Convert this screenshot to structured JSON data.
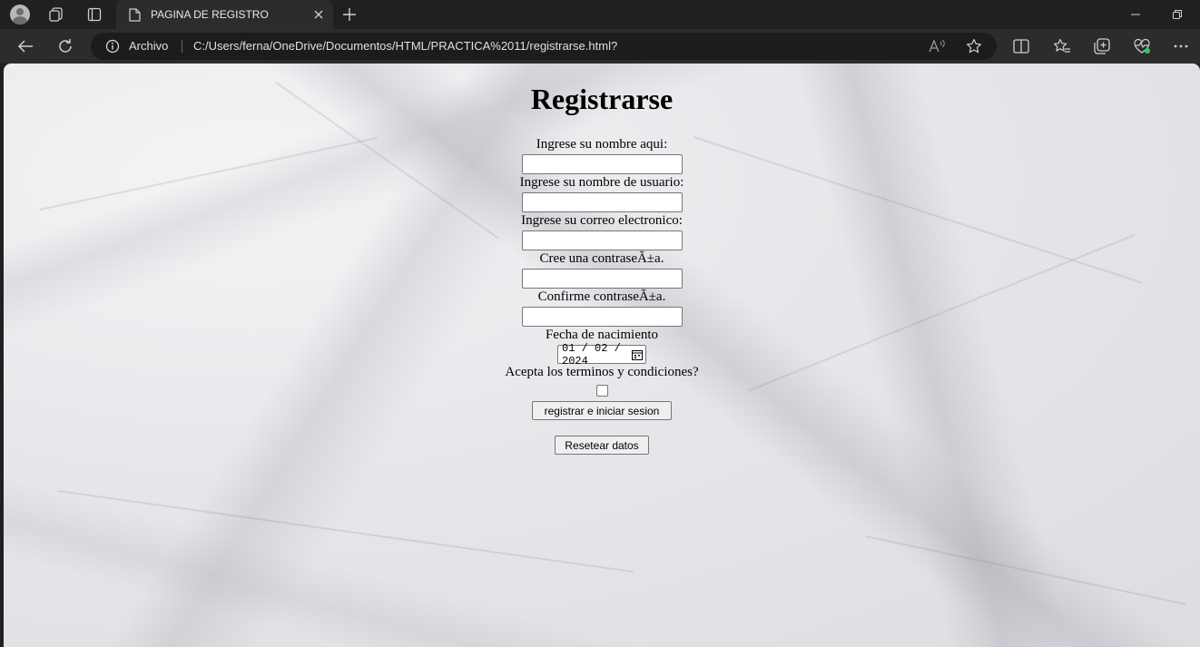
{
  "browser": {
    "tab_title": "PAGINA DE REGISTRO",
    "address_prefix": "Archivo",
    "url": "C:/Users/ferna/OneDrive/Documentos/HTML/PRACTICA%2011/registrarse.html?",
    "read_aloud_label": "A⁾"
  },
  "form": {
    "title": "Registrarse",
    "fields": [
      {
        "label": "Ingrese su nombre aqui:",
        "value": ""
      },
      {
        "label": "Ingrese su nombre de usuario:",
        "value": ""
      },
      {
        "label": "Ingrese su correo electronico:",
        "value": ""
      },
      {
        "label": "Cree una contraseÃ±a.",
        "value": ""
      },
      {
        "label": "Confirme contraseÃ±a.",
        "value": ""
      }
    ],
    "birthdate_label": "Fecha de nacimiento",
    "birthdate_value": "01 / 02 / 2024",
    "terms_label": "Acepta los terminos y condiciones?",
    "terms_checked": false,
    "register_button": "registrar e iniciar sesion",
    "reset_button": "Resetear datos"
  },
  "icons": [
    "profile-icon",
    "workspaces-icon",
    "tab-actions-icon",
    "page-icon",
    "close-icon",
    "new-tab-icon",
    "minimize-icon",
    "restore-icon",
    "back-icon",
    "refresh-icon",
    "info-icon",
    "read-aloud-icon",
    "favorite-star-icon",
    "split-screen-icon",
    "favorites-icon",
    "collections-icon",
    "browser-essentials-icon",
    "more-icon",
    "calendar-icon"
  ]
}
